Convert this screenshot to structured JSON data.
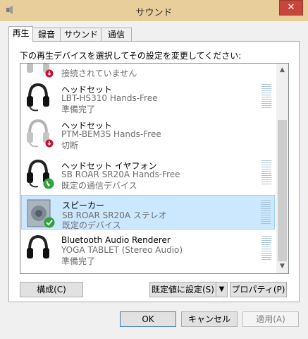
{
  "window": {
    "title": "サウンド",
    "close_glyph": "✕"
  },
  "tabs": [
    {
      "label": "再生",
      "active": true
    },
    {
      "label": "録音",
      "active": false
    },
    {
      "label": "サウンド",
      "active": false
    },
    {
      "label": "通信",
      "active": false
    }
  ],
  "instruction": "下の再生デバイスを選択してその設定を変更してください:",
  "devices": [
    {
      "name": "",
      "line1": "接続されていません",
      "line2": "",
      "status_icon": "disconnected-icon",
      "selected": false
    },
    {
      "name": "ヘッドセット",
      "line1": "LBT-HS310 Hands-Free",
      "line2": "準備完了",
      "status_icon": "none",
      "selected": false
    },
    {
      "name": "ヘッドセット",
      "line1": "PTM-BEM3S Hands-Free",
      "line2": "切断",
      "status_icon": "disconnected-icon",
      "selected": false
    },
    {
      "name": "ヘッドセット イヤフォン",
      "line1": "SB ROAR SR20A Hands-Free",
      "line2": "既定の通信デバイス",
      "status_icon": "phone-icon",
      "selected": false
    },
    {
      "name": "スピーカー",
      "line1": "SB ROAR SR20A ステレオ",
      "line2": "既定のデバイス",
      "status_icon": "checkmark-icon",
      "selected": true
    },
    {
      "name": "Bluetooth Audio Renderer",
      "line1": "YOGA TABLET (Stereo Audio)",
      "line2": "準備完了",
      "status_icon": "none",
      "selected": false
    }
  ],
  "buttons": {
    "configure": "構成(C)",
    "set_default": "既定値に設定(S)",
    "set_default_arrow": "▼",
    "properties": "プロパティ(P)",
    "ok": "OK",
    "cancel": "キャンセル",
    "apply": "適用(A)"
  },
  "colors": {
    "selected_bg": "#cce8ff",
    "title_bg": "#e8ce9a",
    "close_bg": "#c7453a"
  }
}
